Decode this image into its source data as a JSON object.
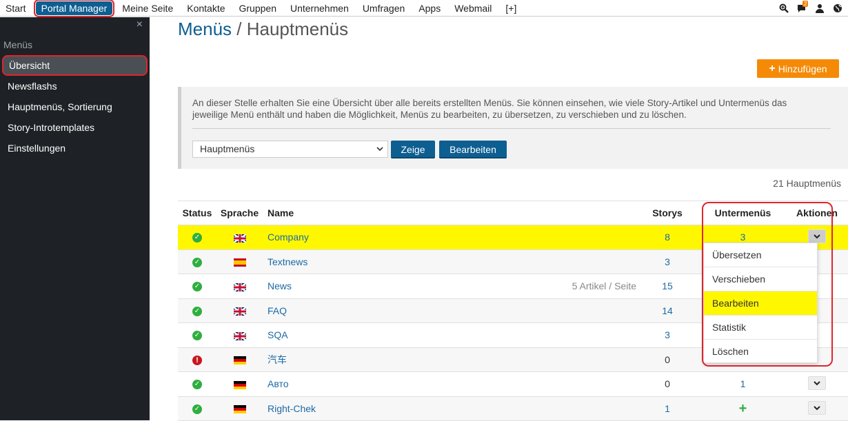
{
  "topnav": {
    "items": [
      {
        "label": "Start"
      },
      {
        "label": "Portal Manager",
        "active": true
      },
      {
        "label": "Meine Seite"
      },
      {
        "label": "Kontakte"
      },
      {
        "label": "Gruppen"
      },
      {
        "label": "Unternehmen"
      },
      {
        "label": "Umfragen"
      },
      {
        "label": "Apps"
      },
      {
        "label": "Webmail"
      },
      {
        "label": "[+]"
      }
    ],
    "icons": [
      "search-zoom-icon",
      "chat-icon",
      "user-icon",
      "globe-icon"
    ],
    "notification_count": "2"
  },
  "sidebar": {
    "close": "×",
    "section_title": "Menüs",
    "items": [
      {
        "label": "Übersicht",
        "active": true
      },
      {
        "label": "Newsflashs"
      },
      {
        "label": "Hauptmenüs, Sortierung"
      },
      {
        "label": "Story-Introtemplates"
      },
      {
        "label": "Einstellungen"
      }
    ]
  },
  "main": {
    "title_crumb": "Menüs",
    "title_sep": " / ",
    "title_page": "Hauptmenüs",
    "add_button": "Hinzufügen",
    "info_text": "An dieser Stelle erhalten Sie eine Übersicht über alle bereits erstellten Menüs. Sie können einsehen, wie viele Story-Artikel und Untermenüs das jeweilige Menü enthält und haben die Möglichkeit, Menüs zu bearbeiten, zu übersetzen, zu verschieben und zu löschen.",
    "select_value": "Hauptmenüs",
    "show_button": "Zeige",
    "edit_button": "Bearbeiten",
    "count_text": "21 Hauptmenüs"
  },
  "table": {
    "headers": {
      "status": "Status",
      "lang": "Sprache",
      "name": "Name",
      "storys": "Storys",
      "sub": "Untermenüs",
      "actions": "Aktionen"
    },
    "rows": [
      {
        "status": "ok",
        "lang": "gb",
        "name": "Company",
        "note": "",
        "storys": "8",
        "sub": "3",
        "highlight": true
      },
      {
        "status": "ok",
        "lang": "es",
        "name": "Textnews",
        "note": "",
        "storys": "3",
        "sub": ""
      },
      {
        "status": "ok",
        "lang": "gb",
        "name": "News",
        "note": "5 Artikel / Seite",
        "storys": "15",
        "sub": ""
      },
      {
        "status": "ok",
        "lang": "gb",
        "name": "FAQ",
        "note": "",
        "storys": "14",
        "sub": ""
      },
      {
        "status": "ok",
        "lang": "gb",
        "name": "SQA",
        "note": "",
        "storys": "3",
        "sub": ""
      },
      {
        "status": "error",
        "lang": "de",
        "name": "汽车",
        "note": "",
        "storys": "0",
        "sub": ""
      },
      {
        "status": "ok",
        "lang": "de",
        "name": "Авто",
        "note": "",
        "storys": "0",
        "sub": "1"
      },
      {
        "status": "ok",
        "lang": "de",
        "name": "Right-Chek",
        "note": "",
        "storys": "1",
        "sub": "+"
      }
    ]
  },
  "dropdown": {
    "items": [
      {
        "label": "Übersetzen"
      },
      {
        "label": "Verschieben"
      },
      {
        "label": "Bearbeiten",
        "highlight": true
      },
      {
        "label": "Statistik"
      },
      {
        "label": "Löschen"
      }
    ]
  }
}
